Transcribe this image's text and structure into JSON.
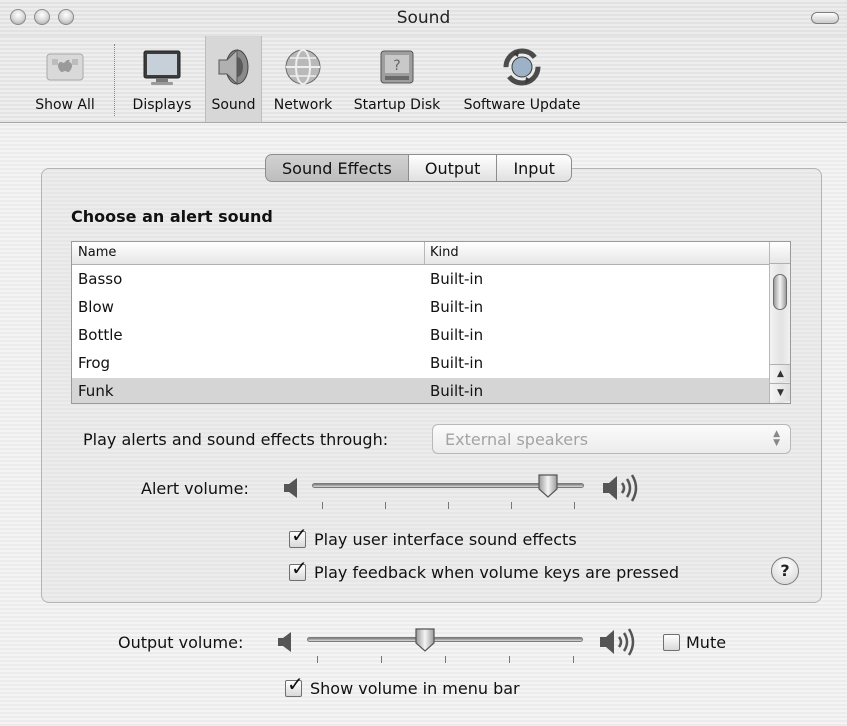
{
  "window": {
    "title": "Sound"
  },
  "toolbar": {
    "items": [
      {
        "label": "Show All",
        "icon": "apple-logo-icon"
      },
      {
        "label": "Displays",
        "icon": "display-icon"
      },
      {
        "label": "Sound",
        "icon": "speaker-icon",
        "selected": true
      },
      {
        "label": "Network",
        "icon": "globe-icon"
      },
      {
        "label": "Startup Disk",
        "icon": "disk-icon"
      },
      {
        "label": "Software Update",
        "icon": "update-icon"
      }
    ]
  },
  "tabs": [
    {
      "label": "Sound Effects",
      "selected": true
    },
    {
      "label": "Output",
      "selected": false
    },
    {
      "label": "Input",
      "selected": false
    }
  ],
  "alerts": {
    "heading": "Choose an alert sound",
    "columns": [
      "Name",
      "Kind"
    ],
    "rows": [
      {
        "name": "Basso",
        "kind": "Built-in"
      },
      {
        "name": "Blow",
        "kind": "Built-in"
      },
      {
        "name": "Bottle",
        "kind": "Built-in"
      },
      {
        "name": "Frog",
        "kind": "Built-in"
      },
      {
        "name": "Funk",
        "kind": "Built-in",
        "selected": true
      }
    ]
  },
  "play_through": {
    "label": "Play alerts and sound effects through:",
    "value": "External speakers"
  },
  "alert_volume": {
    "label": "Alert volume:",
    "level": 0.9
  },
  "checkboxes": {
    "ui_sounds": {
      "label": "Play user interface sound effects",
      "checked": true
    },
    "feedback": {
      "label": "Play feedback when volume keys are pressed",
      "checked": true
    },
    "mute": {
      "label": "Mute",
      "checked": false
    },
    "menu_bar": {
      "label": "Show volume in menu bar",
      "checked": true
    }
  },
  "output_volume": {
    "label": "Output volume:",
    "level": 0.42
  },
  "help": {
    "label": "?"
  },
  "colors": {
    "selected_row": "#d5d5d5",
    "window_bg": "#ececec"
  }
}
